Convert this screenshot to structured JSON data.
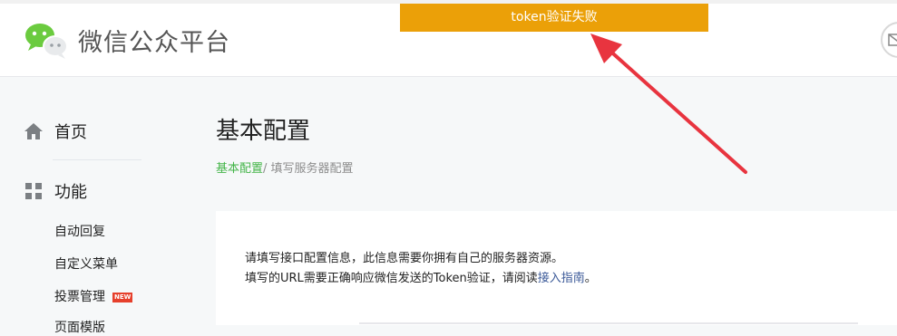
{
  "header": {
    "brand": "微信公众平台",
    "toast": "token验证失败"
  },
  "sidebar": {
    "home_label": "首页",
    "features_label": "功能",
    "sub_items": [
      "自动回复",
      "自定义菜单",
      "投票管理",
      "页面模版"
    ],
    "new_badge": "NEW"
  },
  "main": {
    "title": "基本配置",
    "breadcrumb": {
      "active": "基本配置",
      "current": "/ 填写服务器配置"
    },
    "description": {
      "line1": "请填写接口配置信息，此信息需要你拥有自己的服务器资源。",
      "line2_prefix": "填写的URL需要正确响应微信发送的Token验证，请阅读",
      "line2_link": "接入指南",
      "line2_suffix": "。"
    }
  },
  "colors": {
    "toast": "#eba008",
    "annotation_arrow": "#e8343f",
    "breadcrumb_active": "#44b549",
    "link": "#3b5998",
    "new_badge": "#e6402c"
  }
}
